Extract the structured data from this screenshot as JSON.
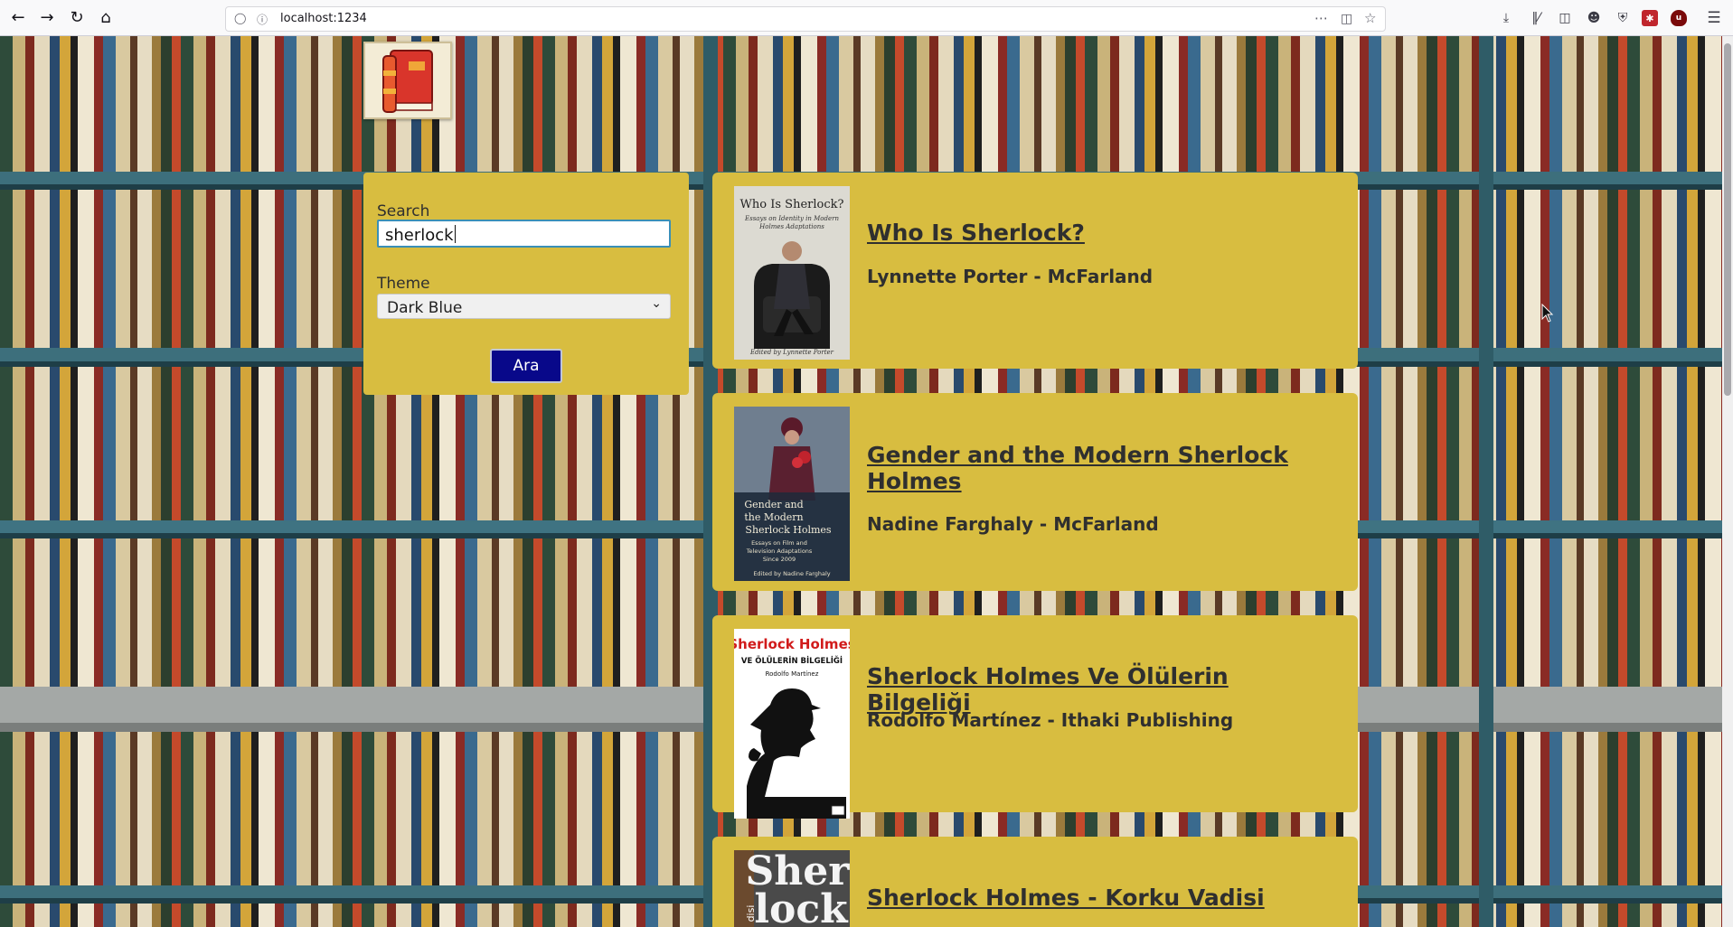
{
  "browser": {
    "url": "localhost:1234"
  },
  "search_panel": {
    "search_label": "Search",
    "search_value": "sherlock",
    "theme_label": "Theme",
    "theme_value": "Dark Blue",
    "submit_label": "Ara"
  },
  "results": [
    {
      "title": "Who Is Sherlock?",
      "meta": "Lynnette Porter - McFarland",
      "cover_text": [
        "Who Is Sherlock?",
        "Essays on Identity in Modern",
        "Holmes Adaptations",
        "Edited by Lynnette Porter"
      ]
    },
    {
      "title": "Gender and the Modern Sherlock Holmes",
      "meta": "Nadine Farghaly - McFarland",
      "cover_text": [
        "Gender and",
        "the Modern",
        "Sherlock Holmes",
        "Essays on Film and",
        "Television Adaptations",
        "Since 2009",
        "Edited by Nadine Farghaly"
      ]
    },
    {
      "title": "Sherlock Holmes Ve Ölülerin Bilgeliği",
      "meta": "Rodolfo Martínez - Ithaki Publishing",
      "cover_text": [
        "Sherlock Holmes",
        "VE ÖLÜLERİN BİLGELİĞİ",
        "Rodolfo Martínez"
      ]
    },
    {
      "title": "Sherlock Holmes - Korku Vadisi",
      "meta": "",
      "cover_text": [
        "Sher",
        "lock",
        "disi"
      ]
    }
  ],
  "colors": {
    "card": "#d8bd40",
    "button": "#08088a",
    "text": "#2f2f2f"
  }
}
